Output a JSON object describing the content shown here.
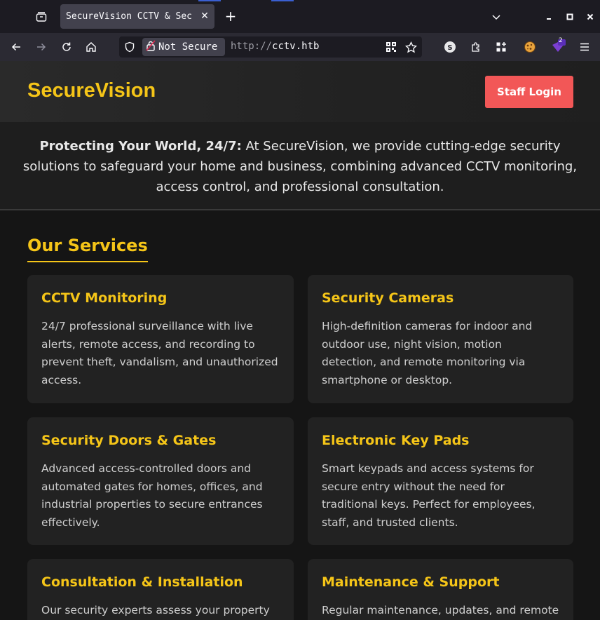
{
  "browser": {
    "tab_title": "SecureVision CCTV & Sec",
    "security_label": "Not Secure",
    "url_protocol": "http://",
    "url_host": "cctv.htb",
    "extension_badge": "2"
  },
  "site": {
    "logo": "SecureVision",
    "staff_login": "Staff Login",
    "intro_bold": "Protecting Your World, 24/7:",
    "intro_text": " At SecureVision, we provide cutting-edge security solutions to safeguard your home and business, combining advanced CCTV monitoring, access control, and professional consultation.",
    "services_title": "Our Services",
    "services": [
      {
        "title": "CCTV Monitoring",
        "text": "24/7 professional surveillance with live alerts, remote access, and recording to prevent theft, vandalism, and unauthorized access."
      },
      {
        "title": "Security Cameras",
        "text": "High-definition cameras for indoor and outdoor use, night vision, motion detection, and remote monitoring via smartphone or desktop."
      },
      {
        "title": "Security Doors & Gates",
        "text": "Advanced access-controlled doors and automated gates for homes, offices, and industrial properties to secure entrances effectively."
      },
      {
        "title": "Electronic Key Pads",
        "text": "Smart keypads and access systems for secure entry without the need for traditional keys. Perfect for employees, staff, and trusted clients."
      },
      {
        "title": "Consultation & Installation",
        "text": "Our security experts assess your property"
      },
      {
        "title": "Maintenance & Support",
        "text": "Regular maintenance, updates, and remote"
      }
    ]
  },
  "colors": {
    "accent": "#f5c518",
    "login_button": "#f25757",
    "background": "#151515",
    "card": "#222222"
  }
}
